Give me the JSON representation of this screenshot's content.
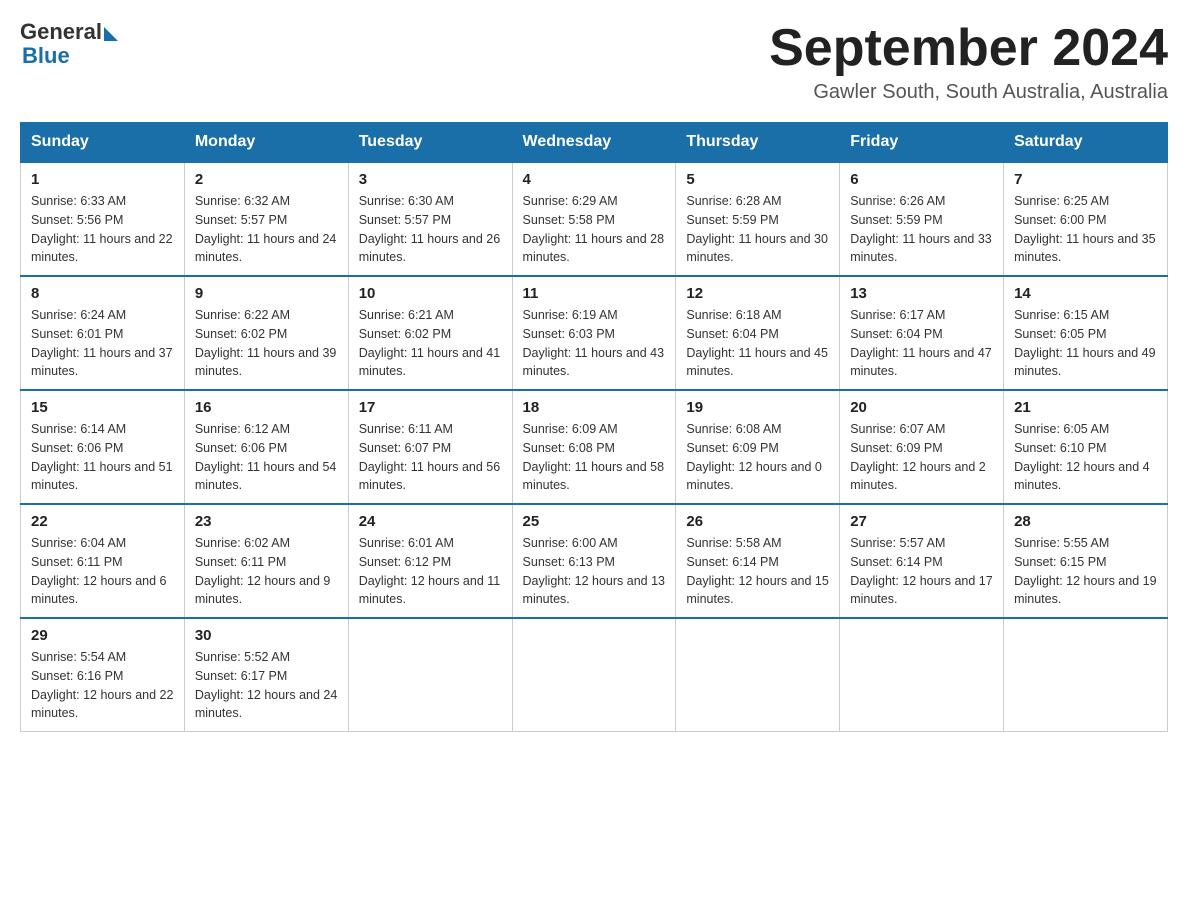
{
  "header": {
    "logo_text_general": "General",
    "logo_text_blue": "Blue",
    "month_title": "September 2024",
    "location": "Gawler South, South Australia, Australia"
  },
  "weekdays": [
    "Sunday",
    "Monday",
    "Tuesday",
    "Wednesday",
    "Thursday",
    "Friday",
    "Saturday"
  ],
  "weeks": [
    [
      {
        "day": "1",
        "sunrise": "6:33 AM",
        "sunset": "5:56 PM",
        "daylight": "11 hours and 22 minutes."
      },
      {
        "day": "2",
        "sunrise": "6:32 AM",
        "sunset": "5:57 PM",
        "daylight": "11 hours and 24 minutes."
      },
      {
        "day": "3",
        "sunrise": "6:30 AM",
        "sunset": "5:57 PM",
        "daylight": "11 hours and 26 minutes."
      },
      {
        "day": "4",
        "sunrise": "6:29 AM",
        "sunset": "5:58 PM",
        "daylight": "11 hours and 28 minutes."
      },
      {
        "day": "5",
        "sunrise": "6:28 AM",
        "sunset": "5:59 PM",
        "daylight": "11 hours and 30 minutes."
      },
      {
        "day": "6",
        "sunrise": "6:26 AM",
        "sunset": "5:59 PM",
        "daylight": "11 hours and 33 minutes."
      },
      {
        "day": "7",
        "sunrise": "6:25 AM",
        "sunset": "6:00 PM",
        "daylight": "11 hours and 35 minutes."
      }
    ],
    [
      {
        "day": "8",
        "sunrise": "6:24 AM",
        "sunset": "6:01 PM",
        "daylight": "11 hours and 37 minutes."
      },
      {
        "day": "9",
        "sunrise": "6:22 AM",
        "sunset": "6:02 PM",
        "daylight": "11 hours and 39 minutes."
      },
      {
        "day": "10",
        "sunrise": "6:21 AM",
        "sunset": "6:02 PM",
        "daylight": "11 hours and 41 minutes."
      },
      {
        "day": "11",
        "sunrise": "6:19 AM",
        "sunset": "6:03 PM",
        "daylight": "11 hours and 43 minutes."
      },
      {
        "day": "12",
        "sunrise": "6:18 AM",
        "sunset": "6:04 PM",
        "daylight": "11 hours and 45 minutes."
      },
      {
        "day": "13",
        "sunrise": "6:17 AM",
        "sunset": "6:04 PM",
        "daylight": "11 hours and 47 minutes."
      },
      {
        "day": "14",
        "sunrise": "6:15 AM",
        "sunset": "6:05 PM",
        "daylight": "11 hours and 49 minutes."
      }
    ],
    [
      {
        "day": "15",
        "sunrise": "6:14 AM",
        "sunset": "6:06 PM",
        "daylight": "11 hours and 51 minutes."
      },
      {
        "day": "16",
        "sunrise": "6:12 AM",
        "sunset": "6:06 PM",
        "daylight": "11 hours and 54 minutes."
      },
      {
        "day": "17",
        "sunrise": "6:11 AM",
        "sunset": "6:07 PM",
        "daylight": "11 hours and 56 minutes."
      },
      {
        "day": "18",
        "sunrise": "6:09 AM",
        "sunset": "6:08 PM",
        "daylight": "11 hours and 58 minutes."
      },
      {
        "day": "19",
        "sunrise": "6:08 AM",
        "sunset": "6:09 PM",
        "daylight": "12 hours and 0 minutes."
      },
      {
        "day": "20",
        "sunrise": "6:07 AM",
        "sunset": "6:09 PM",
        "daylight": "12 hours and 2 minutes."
      },
      {
        "day": "21",
        "sunrise": "6:05 AM",
        "sunset": "6:10 PM",
        "daylight": "12 hours and 4 minutes."
      }
    ],
    [
      {
        "day": "22",
        "sunrise": "6:04 AM",
        "sunset": "6:11 PM",
        "daylight": "12 hours and 6 minutes."
      },
      {
        "day": "23",
        "sunrise": "6:02 AM",
        "sunset": "6:11 PM",
        "daylight": "12 hours and 9 minutes."
      },
      {
        "day": "24",
        "sunrise": "6:01 AM",
        "sunset": "6:12 PM",
        "daylight": "12 hours and 11 minutes."
      },
      {
        "day": "25",
        "sunrise": "6:00 AM",
        "sunset": "6:13 PM",
        "daylight": "12 hours and 13 minutes."
      },
      {
        "day": "26",
        "sunrise": "5:58 AM",
        "sunset": "6:14 PM",
        "daylight": "12 hours and 15 minutes."
      },
      {
        "day": "27",
        "sunrise": "5:57 AM",
        "sunset": "6:14 PM",
        "daylight": "12 hours and 17 minutes."
      },
      {
        "day": "28",
        "sunrise": "5:55 AM",
        "sunset": "6:15 PM",
        "daylight": "12 hours and 19 minutes."
      }
    ],
    [
      {
        "day": "29",
        "sunrise": "5:54 AM",
        "sunset": "6:16 PM",
        "daylight": "12 hours and 22 minutes."
      },
      {
        "day": "30",
        "sunrise": "5:52 AM",
        "sunset": "6:17 PM",
        "daylight": "12 hours and 24 minutes."
      },
      null,
      null,
      null,
      null,
      null
    ]
  ]
}
